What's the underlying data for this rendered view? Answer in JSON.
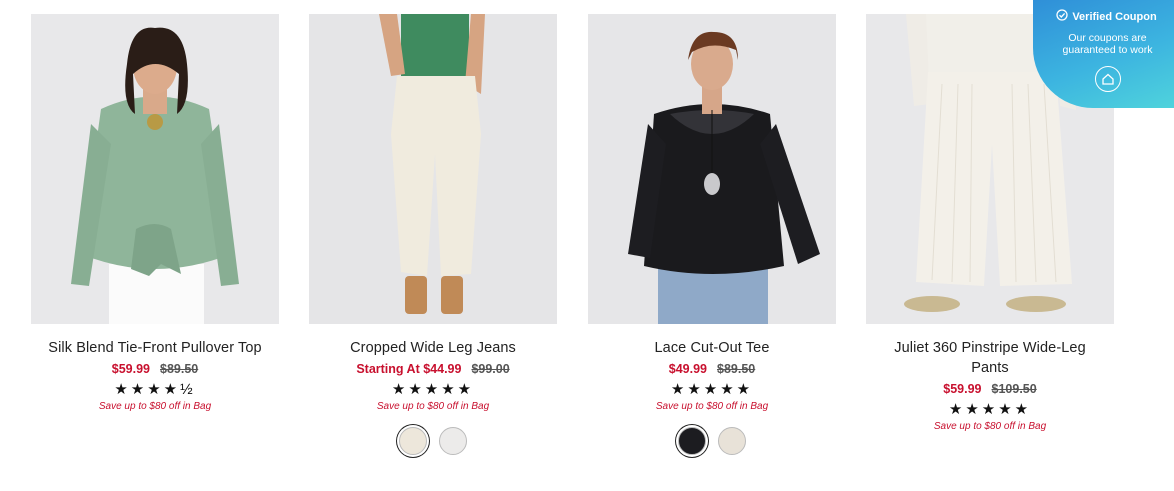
{
  "products": [
    {
      "name": "Silk Blend Tie-Front Pullover Top",
      "sale_price": "$59.99",
      "original_price": "$89.50",
      "rating": 4.5,
      "stars": "★★★★½",
      "promo": "Save up to $80 off in Bag",
      "swatches": []
    },
    {
      "name": "Cropped Wide Leg Jeans",
      "sale_price": "Starting At $44.99",
      "original_price": "$99.00",
      "rating": 5,
      "stars": "★★★★★",
      "promo": "Save up to $80 off in Bag",
      "swatches": [
        {
          "color": "#ede7db",
          "selected": true
        },
        {
          "color": "#ecebea",
          "selected": false
        }
      ]
    },
    {
      "name": "Lace Cut-Out Tee",
      "sale_price": "$49.99",
      "original_price": "$89.50",
      "rating": 5,
      "stars": "★★★★★",
      "promo": "Save up to $80 off in Bag",
      "swatches": [
        {
          "color": "#1c1c20",
          "selected": true
        },
        {
          "color": "#e8e2d8",
          "selected": false
        }
      ]
    },
    {
      "name": "Juliet 360 Pinstripe Wide-Leg Pants",
      "sale_price": "$59.99",
      "original_price": "$109.50",
      "rating": 5,
      "stars": "★★★★★",
      "promo": "Save up to $80 off in Bag",
      "swatches": []
    }
  ],
  "coupon_badge": {
    "title": "Verified Coupon",
    "subtitle": "Our coupons are guaranteed to work",
    "icon": "check-circle-icon",
    "logo_icon": "tag-home-icon"
  },
  "colors": {
    "sale": "#c8102e",
    "badge_gradient_start": "#2f8fd8",
    "badge_gradient_end": "#4fd3dc"
  }
}
